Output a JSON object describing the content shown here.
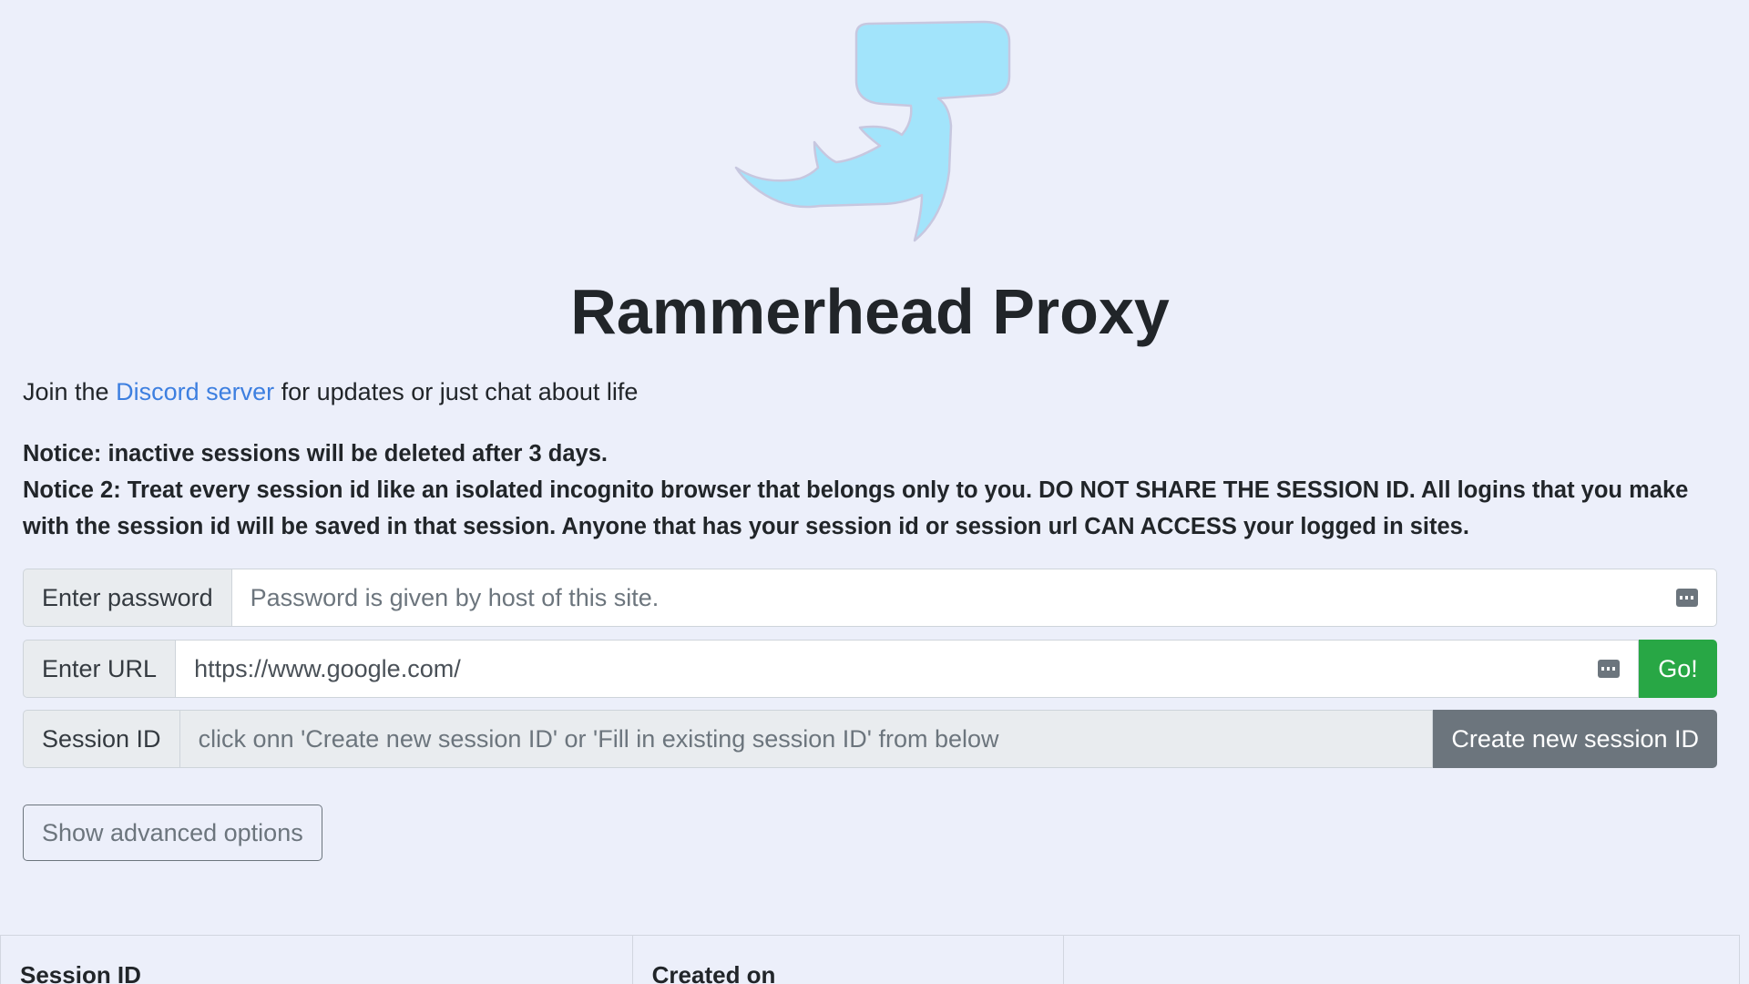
{
  "title": "Rammerhead Proxy",
  "discord": {
    "prefix": "Join the ",
    "link_text": "Discord server",
    "suffix": " for updates or just chat about life"
  },
  "notices": [
    "Notice: inactive sessions will be deleted after 3 days.",
    "Notice 2: Treat every session id like an isolated incognito browser that belongs only to you. DO NOT SHARE THE SESSION ID. All logins that you make with the session id will be saved in that session. Anyone that has your session id or session url CAN ACCESS your logged in sites."
  ],
  "password": {
    "label": "Enter password",
    "placeholder": "Password is given by host of this site."
  },
  "url": {
    "label": "Enter URL",
    "value": "https://www.google.com/",
    "go_label": "Go!"
  },
  "session": {
    "label": "Session ID",
    "placeholder": "click onn 'Create new session ID' or 'Fill in existing session ID' from below",
    "create_label": "Create new session ID"
  },
  "advanced_label": "Show advanced options",
  "table": {
    "headers": [
      "Session ID",
      "Created on",
      ""
    ]
  },
  "colors": {
    "background": "#eceffa",
    "link": "#3d7fe0",
    "go_button": "#28a745",
    "secondary_button": "#6c757d",
    "logo_fill": "#a2e4fb"
  }
}
